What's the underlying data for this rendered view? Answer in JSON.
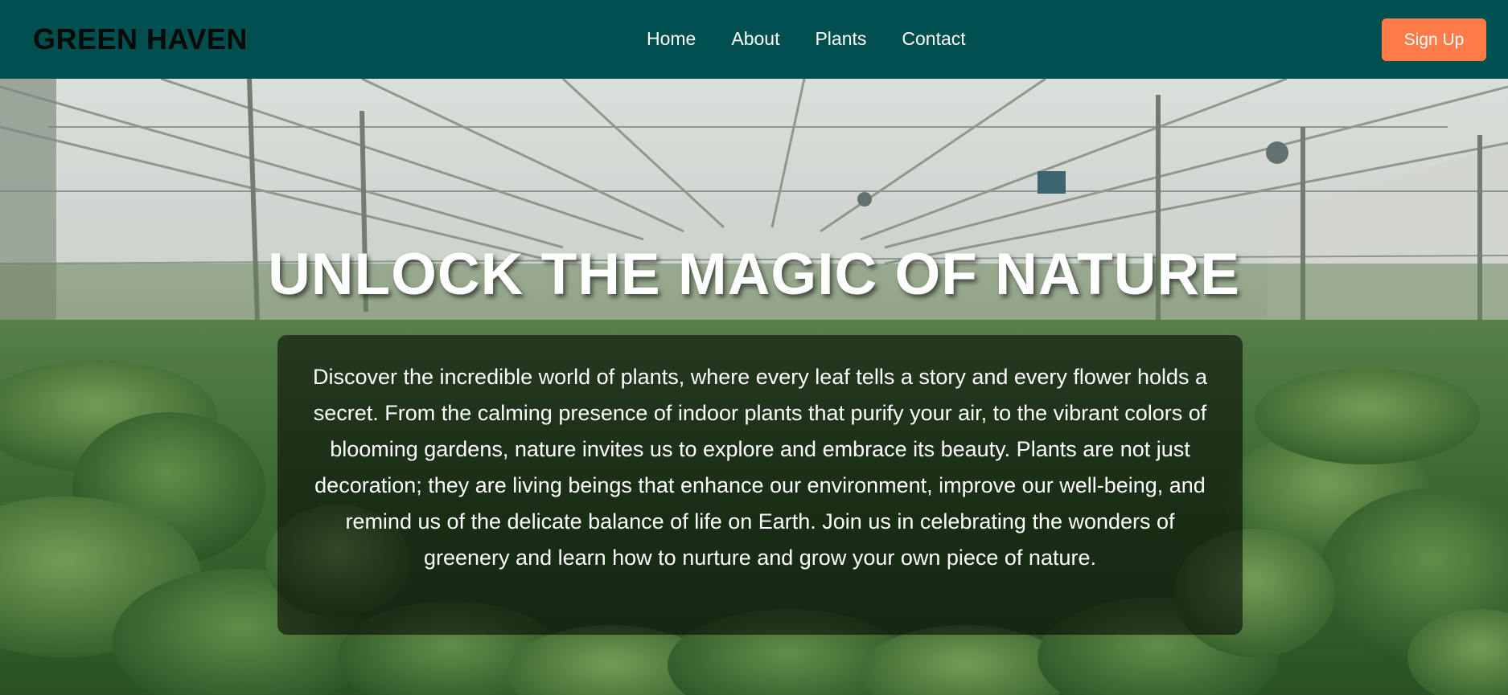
{
  "header": {
    "logo": "GREEN HAVEN",
    "nav": [
      "Home",
      "About",
      "Plants",
      "Contact"
    ],
    "signup_label": "Sign Up"
  },
  "hero": {
    "title": "UNLOCK THE MAGIC OF NATURE",
    "description": "Discover the incredible world of plants, where every leaf tells a story and every flower holds a secret. From the calming presence of indoor plants that purify your air, to the vibrant colors of blooming gardens, nature invites us to explore and embrace its beauty. Plants are not just decoration; they are living beings that enhance our environment, improve our well-being, and remind us of the delicate balance of life on Earth. Join us in celebrating the wonders of greenery and learn how to nurture and grow your own piece of nature."
  },
  "colors": {
    "navbar_bg": "#024f4f",
    "accent": "#ff7c4a",
    "overlay": "rgba(0,0,0,0.55)"
  }
}
